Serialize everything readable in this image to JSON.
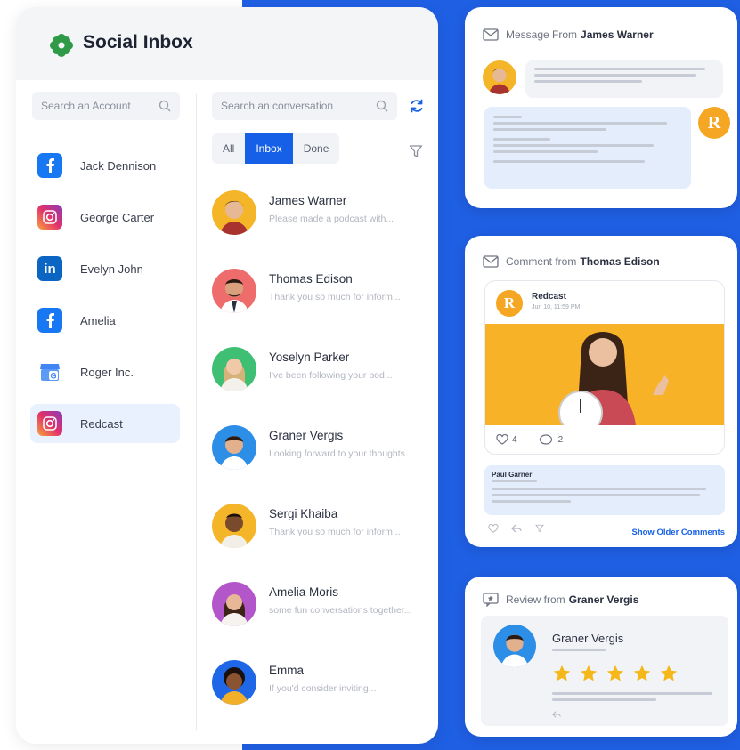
{
  "app": {
    "title": "Social Inbox",
    "brand_color": "#2e9a47"
  },
  "accounts": {
    "search_placeholder": "Search an Account",
    "items": [
      {
        "name": "Jack Dennison",
        "network": "facebook-icon",
        "color": "#1877f2"
      },
      {
        "name": "George Carter",
        "network": "instagram-icon",
        "color": "#e1306c"
      },
      {
        "name": "Evelyn John",
        "network": "linkedin-icon",
        "color": "#0a66c2"
      },
      {
        "name": "Amelia",
        "network": "facebook-icon",
        "color": "#1877f2"
      },
      {
        "name": "Roger Inc.",
        "network": "google-business-icon",
        "color": "#4285f4"
      },
      {
        "name": "Redcast",
        "network": "instagram-icon",
        "color": "#e1306c",
        "selected": true
      }
    ]
  },
  "conversations": {
    "search_placeholder": "Search an conversation",
    "filters": [
      {
        "label": "All"
      },
      {
        "label": "Inbox",
        "active": true
      },
      {
        "label": "Done"
      }
    ],
    "items": [
      {
        "name": "James Warner",
        "preview": "Please made a podcast with..."
      },
      {
        "name": "Thomas Edison",
        "preview": "Thank you so much for inform..."
      },
      {
        "name": "Yoselyn Parker",
        "preview": "I've been following your pod..."
      },
      {
        "name": "Graner Vergis",
        "preview": "Looking forward to your thoughts..."
      },
      {
        "name": "Sergi Khaiba",
        "preview": "Thank you so much for inform..."
      },
      {
        "name": "Amelia Moris",
        "preview": "some fun conversations together..."
      },
      {
        "name": "Emma",
        "preview": "If you'd consider inviting..."
      }
    ]
  },
  "message_card": {
    "title_prefix": "Message From",
    "title_name": "James Warner",
    "reply_initial": "R"
  },
  "comment_card": {
    "title_prefix": "Comment from",
    "title_name": "Thomas Edison",
    "post_author": "Redcast",
    "post_date": "Jun 10, 11:59 PM",
    "post_initial": "R",
    "likes": "4",
    "comments": "2",
    "commenter": "Paul Garner",
    "show_older": "Show Older Comments"
  },
  "review_card": {
    "title_prefix": "Review from",
    "title_name": "Graner Vergis",
    "reviewer": "Graner Vergis",
    "rating": 5,
    "rating_max": 5
  },
  "colors": {
    "accent": "#1560e6",
    "background_blue": "#1f5fe3",
    "star": "#f5b81b",
    "redcast_orange": "#f5a623"
  }
}
